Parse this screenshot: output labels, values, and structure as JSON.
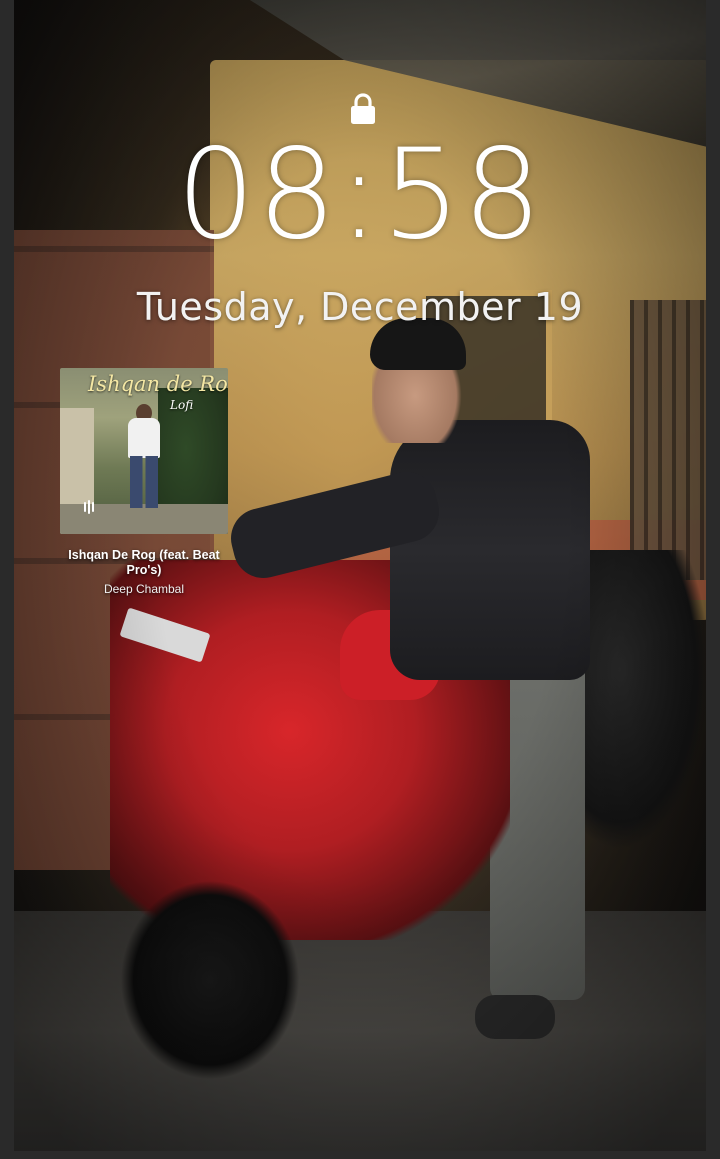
{
  "lockscreen": {
    "lock_icon": "lock-icon",
    "time": "08:58",
    "date": "Tuesday, December 19"
  },
  "media": {
    "album_art_title": "Ishqan de Rog",
    "album_art_subtitle": "Lofi",
    "track_title": "Ishqan De Rog (feat. Beat Pro's)",
    "artist": "Deep Chambal",
    "playback_icon": "pause-icon"
  },
  "colors": {
    "clock_text": "#ffffff",
    "album_title_text": "#f4e7a4"
  }
}
